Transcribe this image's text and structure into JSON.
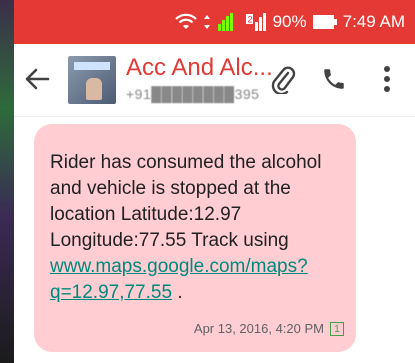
{
  "status_bar": {
    "battery": "90%",
    "time": "7:49 AM"
  },
  "header": {
    "contact_name": "Acc And Alc...",
    "contact_number": "+91████████395"
  },
  "message": {
    "text": "Rider has consumed the alcohol and vehicle is stopped at the location Latitude:12.97 Longitude:77.55 Track using ",
    "link": "www.maps.google.com/maps?q=12.97,77.55",
    "suffix": " .",
    "timestamp": "Apr 13, 2016, 4:20 PM",
    "sim": "1"
  },
  "colors": {
    "accent": "#e53935",
    "bubble": "#ffcdd2",
    "link": "#00897b"
  },
  "icons": [
    "wifi-icon",
    "signal-icon",
    "battery-icon",
    "back-arrow-icon",
    "paperclip-icon",
    "phone-icon",
    "more-vert-icon",
    "sim-icon"
  ]
}
